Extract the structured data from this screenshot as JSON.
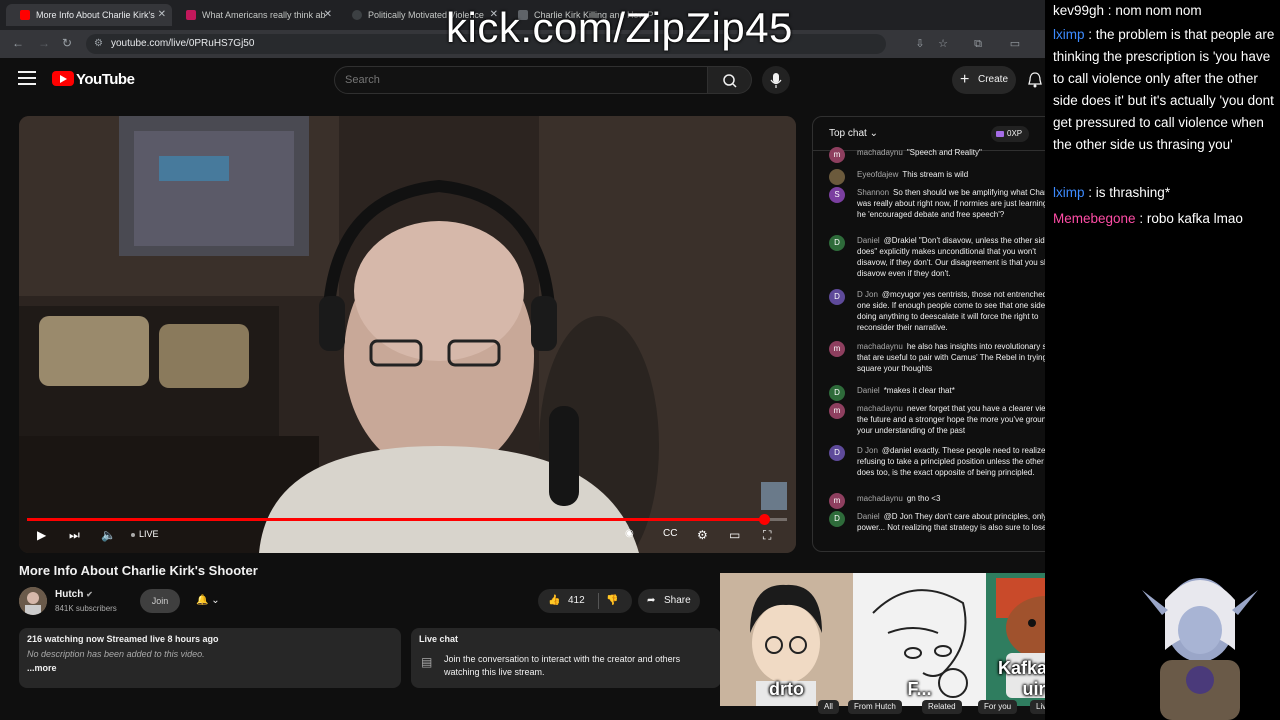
{
  "browser": {
    "tabs": [
      {
        "title": "More Info About Charlie Kirk's",
        "active": true,
        "favicon_color": "#ff0000"
      },
      {
        "title": "What Americans really think ab",
        "active": false,
        "favicon_color": "#c2185b"
      },
      {
        "title": "Politically Motivated Violence",
        "active": false,
        "favicon_color": "#3c4043"
      },
      {
        "title": "Charlie Kirk Killing and How P",
        "active": false,
        "favicon_color": "#5f6368"
      }
    ],
    "url": "youtube.com/live/0PRuHS7Gj50"
  },
  "overlay_title": "kick.com/ZipZip45",
  "youtube": {
    "brand": "YouTube",
    "search_placeholder": "Search",
    "create_label": "Create"
  },
  "player": {
    "live_label": "LIVE",
    "progress": 0.97
  },
  "video": {
    "title": "More Info About Charlie Kirk's Shooter",
    "channel": "Hutch",
    "subscribers": "841K subscribers",
    "join_label": "Join",
    "like_count": "412",
    "share_label": "Share",
    "description": {
      "stats": "216 watching now  Streamed live 8 hours ago",
      "text": "No description has been added to this video.",
      "more": "...more"
    },
    "live_chat_box": {
      "title": "Live chat",
      "text": "Join the conversation to interact with the creator and others watching this live stream."
    }
  },
  "chat": {
    "mode_label": "Top chat",
    "xp_label": "0XP",
    "messages": [
      {
        "author": "machadaynu",
        "text": "\"Speech and Reality\"",
        "avatar_letter": "m",
        "avatar_color": "#8e3f5f"
      },
      {
        "author": "Eyeofdajew",
        "text": "This stream is wild",
        "avatar_letter": "",
        "avatar_color": "#6b5a3c"
      },
      {
        "author": "Shannon",
        "text": "So then should we be amplifying what Charlie was really about right now, if normies are just learning that he 'encouraged debate and free speech'?",
        "avatar_letter": "S",
        "avatar_color": "#7b3fa0"
      },
      {
        "author": "Daniel",
        "text": "@Drakiel \"Don't disavow, unless the other side does\" explicitly makes unconditional that you won't disavow, if they don't. Our disagreement is that you should disavow even if they don't.",
        "avatar_letter": "D",
        "avatar_color": "#2e6b3a"
      },
      {
        "author": "D Jon",
        "text": "@mcyugor yes centrists, those not entrenched on one side. If enough people come to see that one side isn't doing anything to deescalate it will force the right to reconsider their narrative.",
        "avatar_letter": "D",
        "avatar_color": "#5e4a9a"
      },
      {
        "author": "machadaynu",
        "text": "he also has insights into revolutionary spirit that are useful to pair with Camus' The Rebel in trying to square your thoughts",
        "avatar_letter": "m",
        "avatar_color": "#8e3f5f"
      },
      {
        "author": "Daniel",
        "text": "*makes it clear that*",
        "avatar_letter": "D",
        "avatar_color": "#2e6b3a"
      },
      {
        "author": "machadaynu",
        "text": "never forget that you have a clearer view of the future and a stronger hope the more you've grounded your understanding of the past",
        "avatar_letter": "m",
        "avatar_color": "#8e3f5f"
      },
      {
        "author": "D Jon",
        "text": "@daniel exactly. These people need to realize that refusing to take a principled position unless the other side does too, is the exact opposite of being principled.",
        "avatar_letter": "D",
        "avatar_color": "#5e4a9a"
      },
      {
        "author": "machadaynu",
        "text": "gn tho <3",
        "avatar_letter": "m",
        "avatar_color": "#8e3f5f"
      },
      {
        "author": "Daniel",
        "text": "@D Jon They don't care about principles, only power... Not realizing that strategy is also sure to lose.",
        "avatar_letter": "D",
        "avatar_color": "#2e6b3a"
      }
    ]
  },
  "webcams": [
    {
      "label": "drto"
    },
    {
      "label": "F..."
    },
    {
      "label": "KafkaEsq uire"
    }
  ],
  "chips": [
    "All",
    "From Hutch",
    "Related",
    "For you",
    "Live"
  ],
  "stream_chat": [
    {
      "name": "kev99gh",
      "color": "#ffffff",
      "text": "nom nom nom"
    },
    {
      "name": "lximp",
      "color": "#3d8bff",
      "text": "the problem is that people are thinking the prescription is 'you have to call violence only after the other side does it' but it's actually 'you dont get pressured to call violence when the other side us thrasing you'"
    },
    {
      "name": "lximp",
      "color": "#3d8bff",
      "text": "is thrashing*"
    },
    {
      "name": "Memebegone",
      "color": "#ff4da6",
      "text": "robo kafka lmao"
    }
  ]
}
